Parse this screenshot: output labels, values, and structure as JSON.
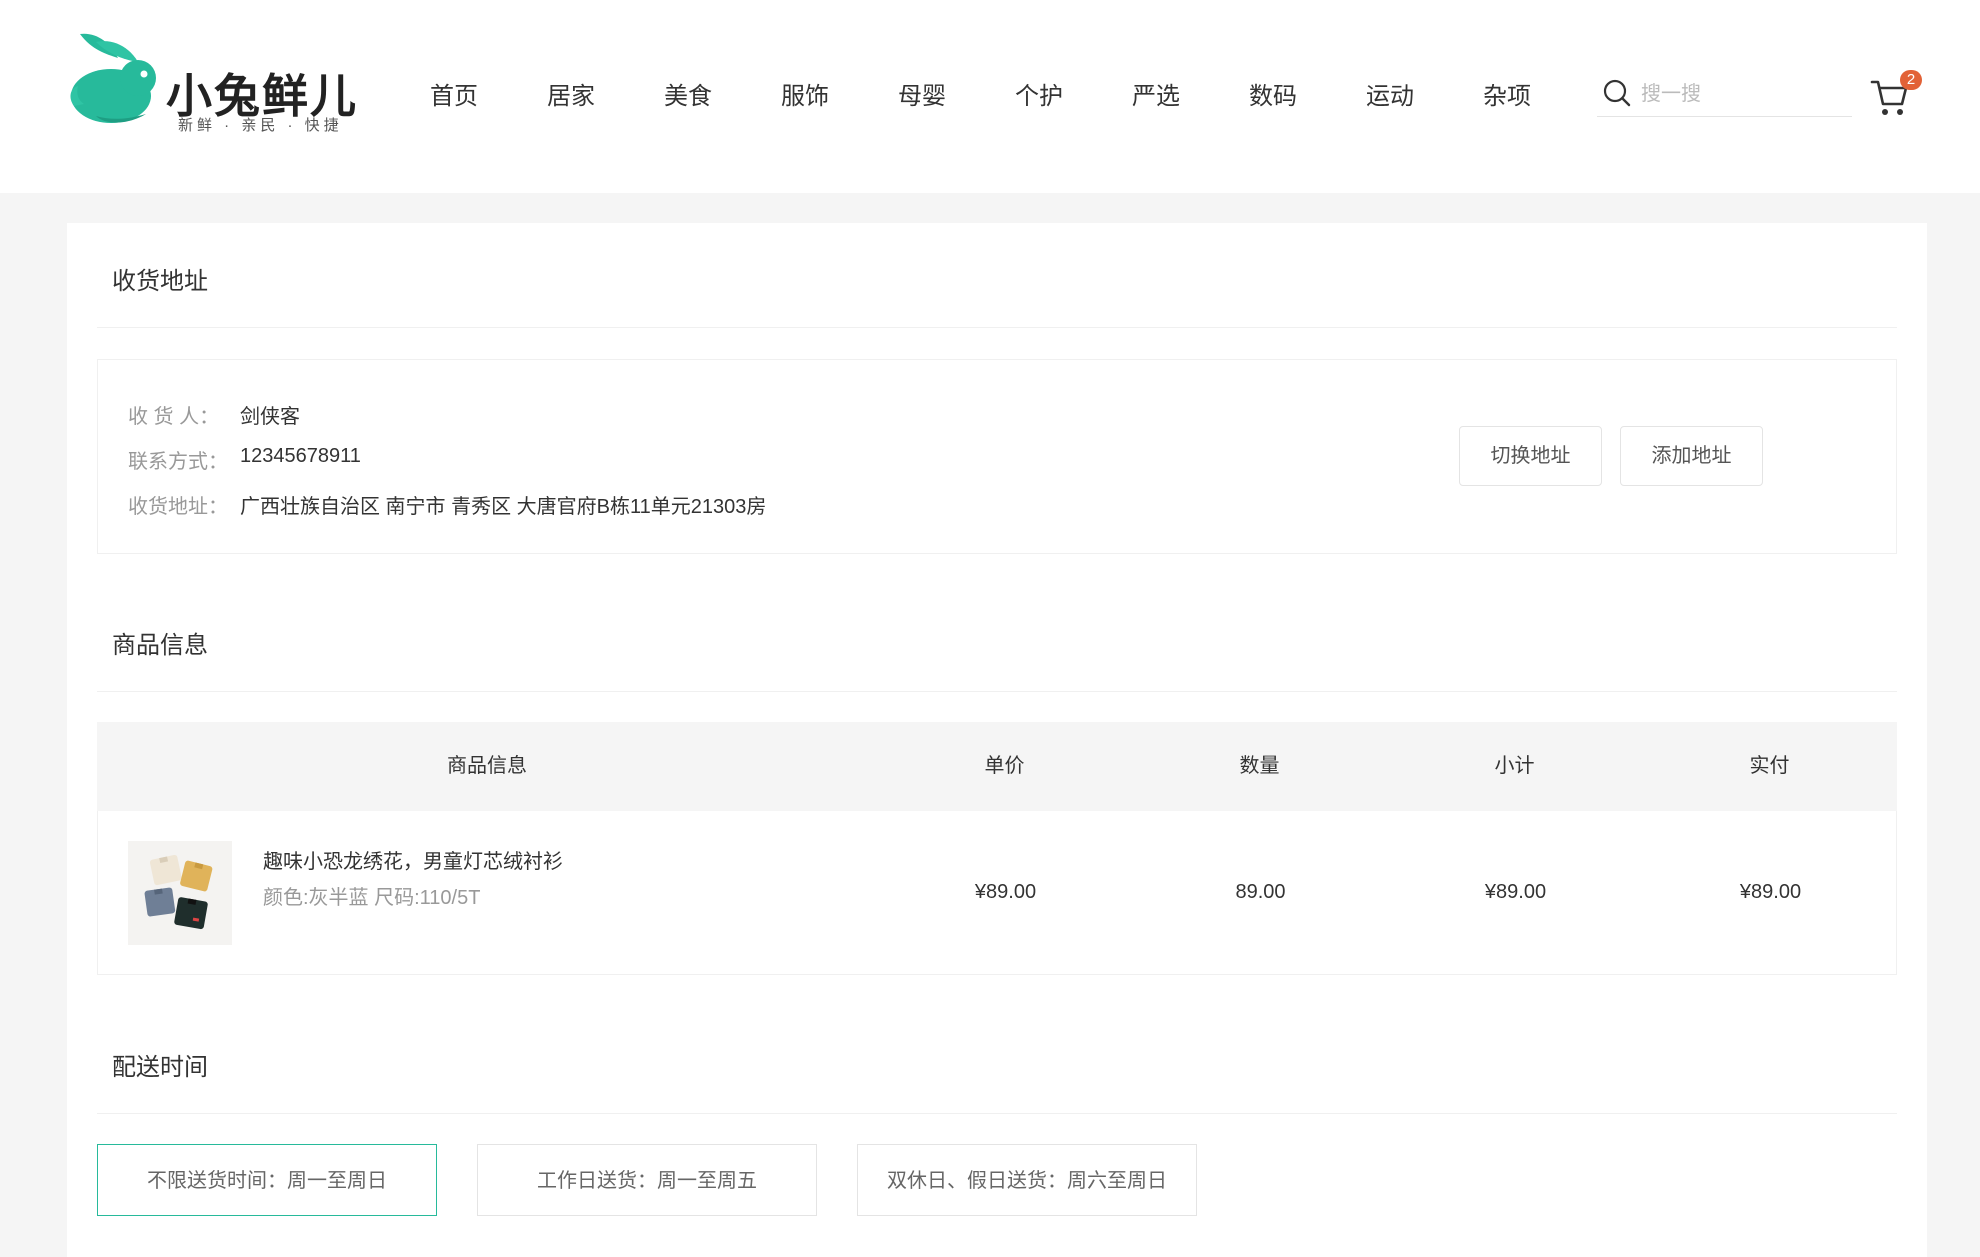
{
  "logo": {
    "name": "小兔鲜儿",
    "slogan": "新鲜 · 亲民 · 快捷",
    "brand_color": "#27ba9b"
  },
  "nav": {
    "items": [
      "首页",
      "居家",
      "美食",
      "服饰",
      "母婴",
      "个护",
      "严选",
      "数码",
      "运动",
      "杂项"
    ]
  },
  "search": {
    "placeholder": "搜一搜",
    "icon": "search-icon"
  },
  "cart": {
    "count": "2",
    "icon": "cart-icon",
    "badge_color": "#e26237"
  },
  "address_section": {
    "title": "收货地址",
    "consignee_label": "收 货 人：",
    "consignee": "剑侠客",
    "phone_label": "联系方式：",
    "phone": "12345678911",
    "address_label": "收货地址：",
    "address": "广西壮族自治区 南宁市 青秀区 大唐官府B栋11单元21303房",
    "switch_button": "切换地址",
    "add_button": "添加地址"
  },
  "goods_section": {
    "title": "商品信息",
    "columns": [
      "商品信息",
      "单价",
      "数量",
      "小计",
      "实付"
    ],
    "rows": [
      {
        "name": "趣味小恐龙绣花，男童灯芯绒衬衫",
        "attrs": "颜色:灰半蓝 尺码:110/5T",
        "price": "¥89.00",
        "quantity": "89.00",
        "subtotal": "¥89.00",
        "paid": "¥89.00"
      }
    ]
  },
  "delivery_section": {
    "title": "配送时间",
    "options": [
      "不限送货时间：周一至周日",
      "工作日送货：周一至周五",
      "双休日、假日送货：周六至周日"
    ],
    "selected": 0,
    "accent_color": "#27ba9b"
  }
}
